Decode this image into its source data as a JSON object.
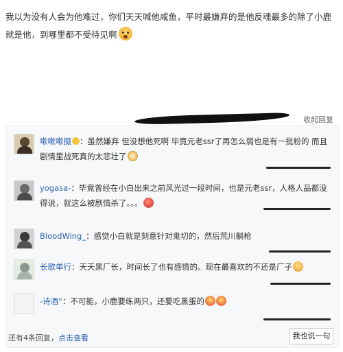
{
  "post": {
    "text": "我以为没有人会为他难过，你们天天喊他咸鱼，平时最嫌弃的是他反魂最多的除了小鹿就是他，到哪里都不受待见啊",
    "emoji": "shocked-face-emoji"
  },
  "collapse_label": "收起回复",
  "replies": [
    {
      "name": "嗽嗽嗽摄",
      "separator": "：",
      "text": "虽然嫌弃 但没想他死啊 毕竟元老ssr了再怎么弱也是有一批粉的 而且剧情里战死真的太悲壮了",
      "emoji": "smile-emoji",
      "avatar_color": "#5a4636",
      "avatar_bg": "#d8ccb0"
    },
    {
      "name": "yogasa-",
      "separator": "：",
      "text": "毕竟曾经在小白出来之前风光过一段时间，也是元老ssr，人格人品都没得说，就这么被剧情杀了。。。",
      "emoji": "sad-emoji",
      "avatar_color": "#6a6a6a",
      "avatar_bg": "#c9c9c9"
    },
    {
      "name": "BloodWing_",
      "separator": "：",
      "text": "感觉小白就是刻意针对鬼切的，然后荒川躺枪",
      "emoji": "",
      "avatar_color": "#3a3a3a",
      "avatar_bg": "#d2d2d2"
    },
    {
      "name": "长歌单行",
      "separator": "：",
      "text": "天天黑厂长，时间长了也有感情的。现在最喜欢的不还是厂子",
      "emoji": "laugh-emoji",
      "avatar_color": "#8a9a8a",
      "avatar_bg": "#e4ece4"
    },
    {
      "name": "-诗酒°",
      "separator": "：",
      "text": "不可能，小鹿要练两只，还要吃黑蛋的",
      "emoji": "grin-emoji",
      "avatar_color": "#f4f4f4",
      "avatar_bg": "#f4f4f4"
    }
  ],
  "more_replies": {
    "prefix": "还有4条回复，",
    "link": "点击查看"
  },
  "say_button": "我也说一句",
  "colors": {
    "name_blue": "#2d64b3",
    "box_bg": "#f7f8fa",
    "emoji_yellow": "#f3b33a",
    "emoji_red": "#e05b4b"
  }
}
